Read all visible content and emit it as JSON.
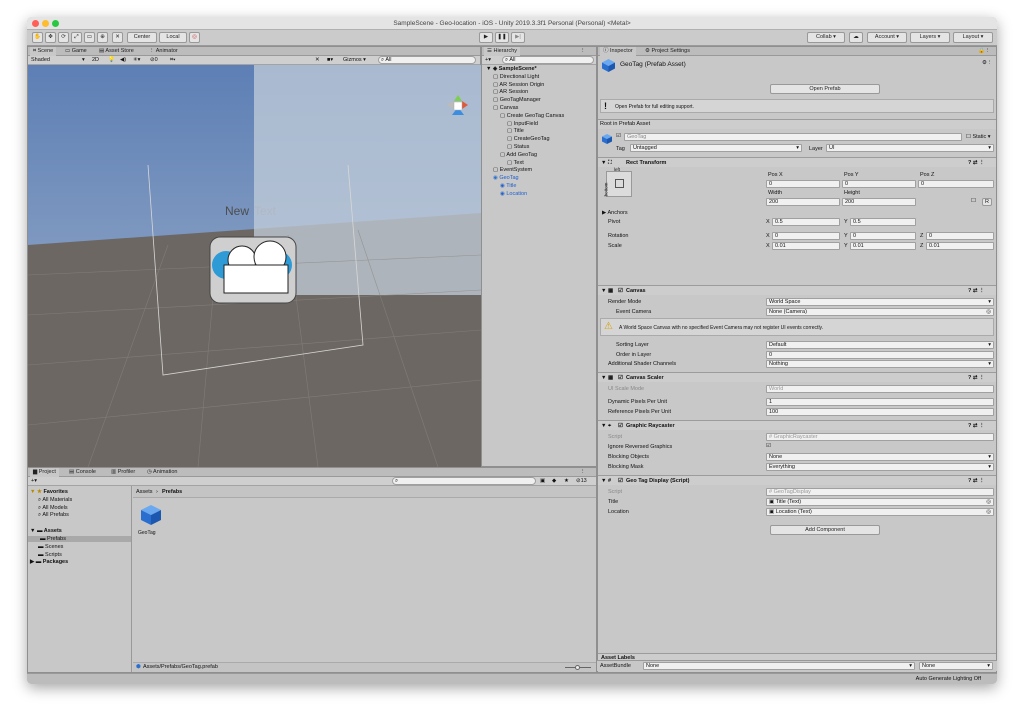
{
  "window": {
    "title": "SampleScene - Geo-location - iOS - Unity 2019.3.3f1 Personal (Personal) <Metal>"
  },
  "toolbar": {
    "center": "Center",
    "local": "Local",
    "collab": "Collab ▾",
    "account": "Account",
    "layers": "Layers",
    "layout": "Layout"
  },
  "scene": {
    "tabs": [
      "Scene",
      "Game",
      "Asset Store",
      "Animator"
    ],
    "shading": "Shaded",
    "mode2d": "2D",
    "gizmos": "Gizmos",
    "search": "All",
    "overlay_text_new": "New",
    "overlay_text_rest": " Text",
    "layers_count": "0"
  },
  "hierarchy": {
    "tab": "Hierarchy",
    "search": "All",
    "items": [
      {
        "label": "SampleScene*",
        "depth": 0,
        "bold": true
      },
      {
        "label": "Directional Light",
        "depth": 1
      },
      {
        "label": "AR Session Origin",
        "depth": 1
      },
      {
        "label": "AR Session",
        "depth": 1
      },
      {
        "label": "GeoTagManager",
        "depth": 1
      },
      {
        "label": "Canvas",
        "depth": 1
      },
      {
        "label": "Create GeoTag Canvas",
        "depth": 2
      },
      {
        "label": "InputField",
        "depth": 3
      },
      {
        "label": "Title",
        "depth": 3
      },
      {
        "label": "CreateGeoTag",
        "depth": 3
      },
      {
        "label": "Status",
        "depth": 3
      },
      {
        "label": "Add GeoTag",
        "depth": 2
      },
      {
        "label": "Text",
        "depth": 3
      },
      {
        "label": "EventSystem",
        "depth": 1
      },
      {
        "label": "GeoTag",
        "depth": 1,
        "blue": true
      },
      {
        "label": "Title",
        "depth": 2,
        "blue": true
      },
      {
        "label": "Location",
        "depth": 2,
        "blue": true
      }
    ]
  },
  "project": {
    "tabs": [
      "Project",
      "Console",
      "Profiler",
      "Animation"
    ],
    "count": "13",
    "tree": [
      {
        "label": "Favorites",
        "depth": 0,
        "bold": true
      },
      {
        "label": "All Materials",
        "depth": 1
      },
      {
        "label": "All Models",
        "depth": 1
      },
      {
        "label": "All Prefabs",
        "depth": 1
      },
      {
        "label": "Assets",
        "depth": 0,
        "bold": true
      },
      {
        "label": "Prefabs",
        "depth": 1,
        "sel": true
      },
      {
        "label": "Scenes",
        "depth": 1
      },
      {
        "label": "Scripts",
        "depth": 1
      },
      {
        "label": "Packages",
        "depth": 0,
        "bold": true
      }
    ],
    "breadcrumb_root": "Assets",
    "breadcrumb_leaf": "Prefabs",
    "asset_label": "GeoTag",
    "path": "Assets/Prefabs/GeoTag.prefab"
  },
  "inspector": {
    "tabs": [
      "Inspector",
      "Project Settings"
    ],
    "title": "GeoTag (Prefab Asset)",
    "open_prefab": "Open Prefab",
    "info": "Open Prefab for full editing support.",
    "root": "Root in Prefab Asset",
    "name": "GeoTag",
    "static": "Static",
    "tag_label": "Tag",
    "tag": "Untagged",
    "layer_label": "Layer",
    "layer": "UI",
    "rect": {
      "title": "Rect Transform",
      "anchor_h": "left",
      "anchor_v": "bottom",
      "posx_l": "Pos X",
      "posy_l": "Pos Y",
      "posz_l": "Pos Z",
      "posx": "0",
      "posy": "0",
      "posz": "0",
      "w_l": "Width",
      "h_l": "Height",
      "w": "200",
      "h": "200",
      "anchors": "Anchors",
      "pivot": "Pivot",
      "pivot_x": "0.5",
      "pivot_y": "0.5",
      "rotation": "Rotation",
      "rx": "0",
      "ry": "0",
      "rz": "0",
      "scale": "Scale",
      "sx": "0.01",
      "sy": "0.01",
      "sz": "0.01",
      "r_btn": "R"
    },
    "canvas": {
      "title": "Canvas",
      "render_mode_l": "Render Mode",
      "render_mode": "World Space",
      "event_camera_l": "Event Camera",
      "event_camera": "None (Camera)",
      "warning": "A World Space Canvas with no specified Event Camera may not register UI events correctly.",
      "sorting_l": "Sorting Layer",
      "sorting": "Default",
      "order_l": "Order in Layer",
      "order": "0",
      "shader_l": "Additional Shader Channels",
      "shader": "Nothing"
    },
    "scaler": {
      "title": "Canvas Scaler",
      "ui_scale_l": "UI Scale Mode",
      "ui_scale": "World",
      "dyn_l": "Dynamic Pixels Per Unit",
      "dyn": "1",
      "ref_l": "Reference Pixels Per Unit",
      "ref": "100"
    },
    "raycaster": {
      "title": "Graphic Raycaster",
      "script_l": "Script",
      "script": "GraphicRaycaster",
      "ignore_l": "Ignore Reversed Graphics",
      "block_l": "Blocking Objects",
      "block": "None",
      "mask_l": "Blocking Mask",
      "mask": "Everything"
    },
    "display": {
      "title": "Geo Tag Display (Script)",
      "script_l": "Script",
      "script": "GeoTagDisplay",
      "title_l": "Title",
      "title_v": "Title (Text)",
      "loc_l": "Location",
      "loc_v": "Location (Text)"
    },
    "add_component": "Add Component",
    "asset_labels": "Asset Labels",
    "bundle_l": "AssetBundle",
    "bundle": "None",
    "bundle2": "None"
  },
  "status": {
    "right": "Auto Generate Lighting Off"
  }
}
